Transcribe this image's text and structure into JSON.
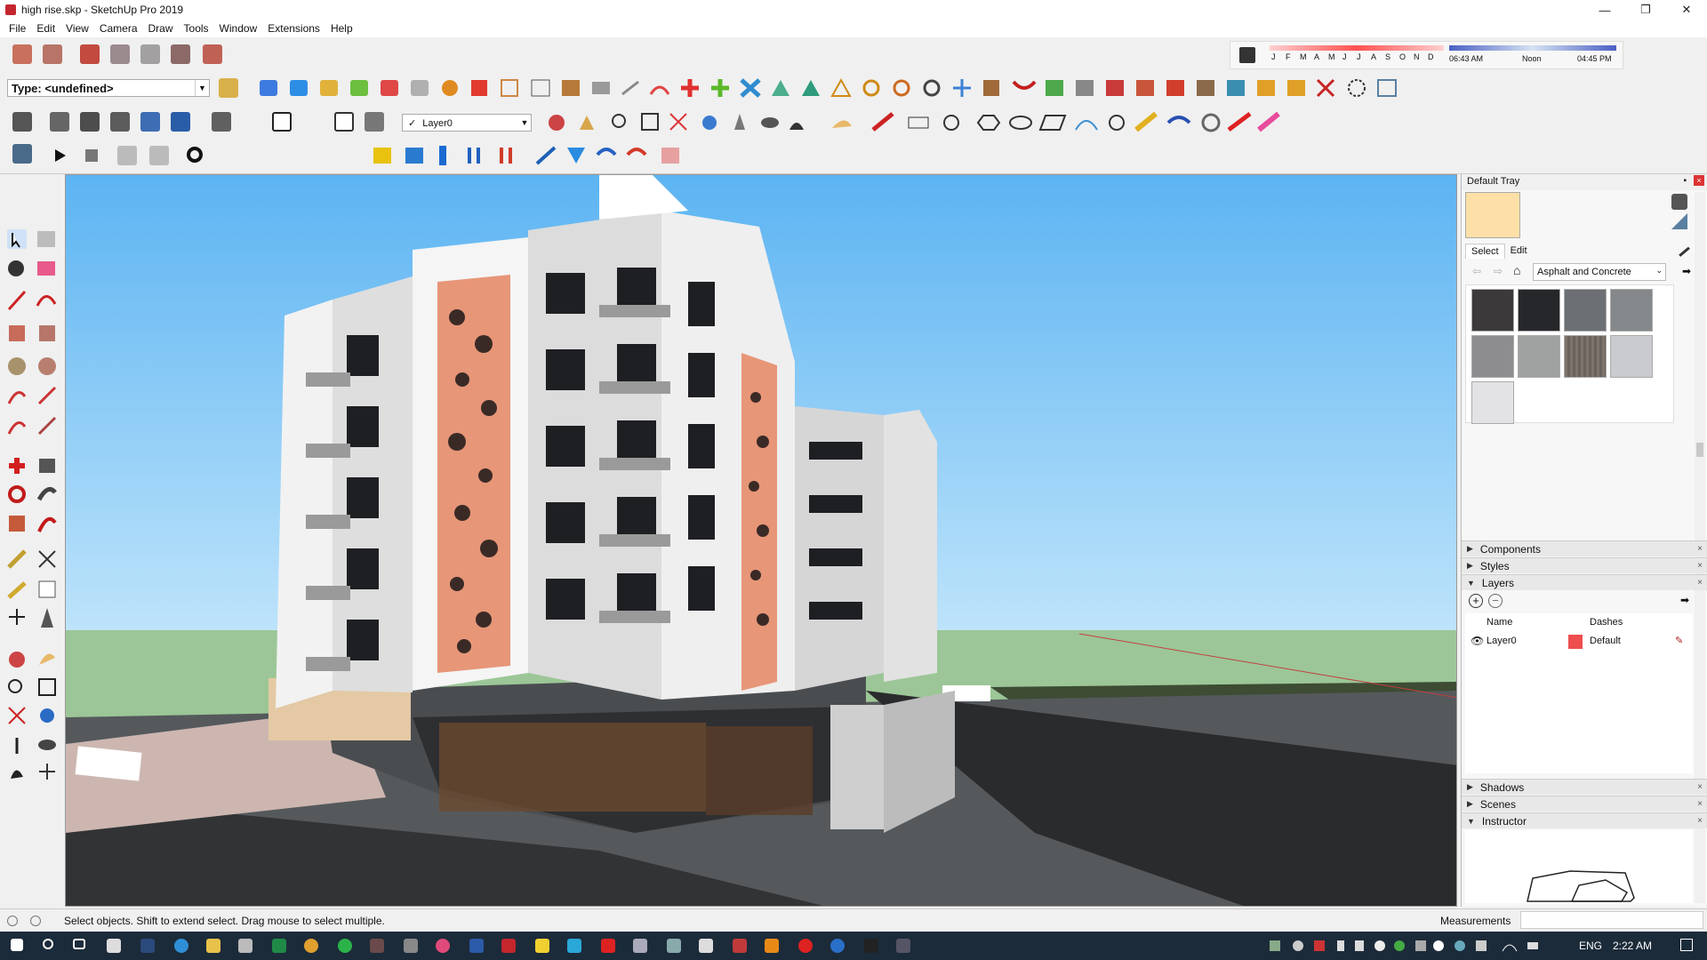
{
  "window": {
    "title": "high rise.skp - SketchUp Pro 2019",
    "minimize": "—",
    "restore": "❐",
    "close": "✕"
  },
  "menu": [
    "File",
    "Edit",
    "View",
    "Camera",
    "Draw",
    "Tools",
    "Window",
    "Extensions",
    "Help"
  ],
  "shadow_bar": {
    "months": [
      "J",
      "F",
      "M",
      "A",
      "M",
      "J",
      "J",
      "A",
      "S",
      "O",
      "N",
      "D"
    ],
    "time_start": "06:43 AM",
    "time_mid": "Noon",
    "time_end": "04:45 PM"
  },
  "type_field": {
    "value": "Type: <undefined>"
  },
  "layer_select": {
    "value": "Layer0",
    "check": "✓"
  },
  "tray": {
    "title": "Default Tray",
    "materials": {
      "tabs": [
        "Select",
        "Edit"
      ],
      "collection": "Asphalt and Concrete",
      "swatches": [
        "#3c393b",
        "#25272a",
        "#6c7074",
        "#85888b",
        "#8d8d8f",
        "#9fa2a1",
        "#7d746c",
        "#c9cbcf",
        "#e3e3e5"
      ]
    },
    "panels_top": [
      {
        "label": "Components",
        "arrow": "▶",
        "close": "×"
      },
      {
        "label": "Styles",
        "arrow": "▶",
        "close": "×"
      },
      {
        "label": "Layers",
        "arrow": "▼",
        "close": "×"
      }
    ],
    "layers": {
      "columns": [
        "Name",
        "Dashes"
      ],
      "rows": [
        {
          "name": "Layer0",
          "dashes": "Default",
          "color": "#ee4e4e"
        }
      ]
    },
    "panels_bottom": [
      {
        "label": "Shadows",
        "arrow": "▶",
        "close": "×"
      },
      {
        "label": "Scenes",
        "arrow": "▶",
        "close": "×"
      },
      {
        "label": "Instructor",
        "arrow": "▼",
        "close": "×"
      }
    ]
  },
  "status": {
    "message": "Select objects. Shift to extend select. Drag mouse to select multiple.",
    "measurements_label": "Measurements"
  },
  "taskbar": {
    "language": "ENG",
    "time": "2:22 AM"
  },
  "colors": {
    "sky": "#6fbdf2",
    "grass": "#97c292",
    "facade_accent": "#e79678",
    "road": "#3d3e40"
  }
}
